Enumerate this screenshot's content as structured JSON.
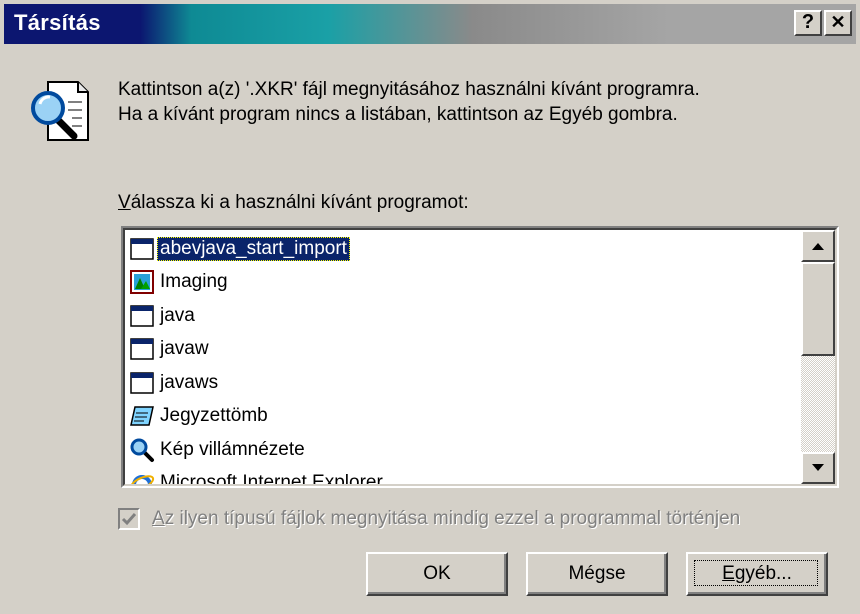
{
  "window": {
    "title": "Társítás",
    "help_label": "?",
    "close_label": "✕"
  },
  "icon": {
    "name": "document-magnifier-icon"
  },
  "message": {
    "line1": "Kattintson a(z) '.XKR' fájl megnyitásához használni kívánt programra.",
    "line2": "Ha a kívánt program nincs a listában, kattintson az Egyéb gombra."
  },
  "list": {
    "label_accel": "V",
    "label_rest": "álassza ki a használni kívánt programot:",
    "items": [
      {
        "label": "abevjava_start_import",
        "icon": "window-app-icon",
        "selected": true
      },
      {
        "label": "Imaging",
        "icon": "imaging-app-icon",
        "selected": false
      },
      {
        "label": "java",
        "icon": "window-app-icon",
        "selected": false
      },
      {
        "label": "javaw",
        "icon": "window-app-icon",
        "selected": false
      },
      {
        "label": "javaws",
        "icon": "window-app-icon",
        "selected": false
      },
      {
        "label": "Jegyzettömb",
        "icon": "notepad-icon",
        "selected": false
      },
      {
        "label": "Kép villámnézete",
        "icon": "magnifier-icon",
        "selected": false
      },
      {
        "label": "Microsoft Internet Explorer",
        "icon": "internet-explorer-icon",
        "selected": false
      }
    ]
  },
  "checkbox": {
    "label_accel": "A",
    "label_rest": "z ilyen típusú fájlok megnyitása mindig ezzel a programmal történjen",
    "checked": true,
    "enabled": false
  },
  "buttons": {
    "ok": "OK",
    "cancel": "Mégse",
    "other_accel": "E",
    "other_rest": "gyéb..."
  },
  "colors": {
    "selection": "#0a246a",
    "face": "#d4d0c8",
    "title_left": "#0c1670"
  }
}
